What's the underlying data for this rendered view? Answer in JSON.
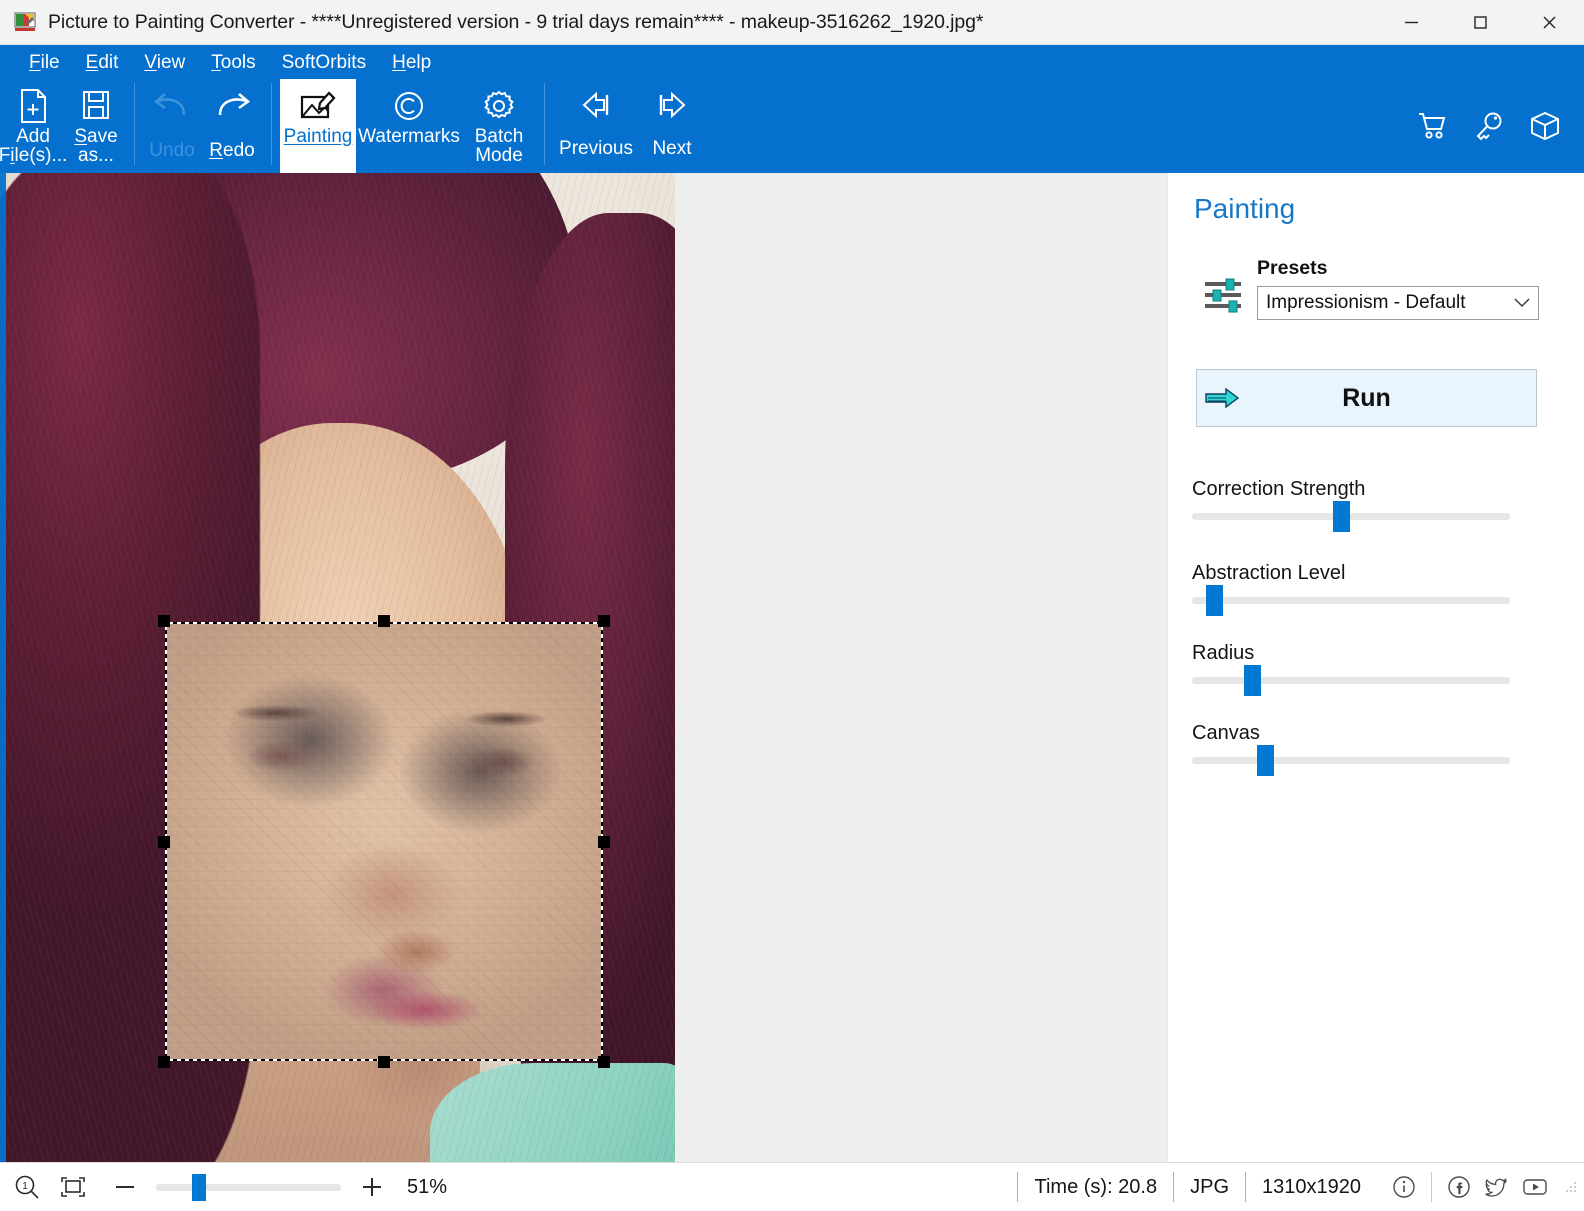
{
  "window": {
    "title": "Picture to Painting Converter - ****Unregistered version - 9 trial days remain**** - makeup-3516262_1920.jpg*",
    "app_icon": "picture-to-painting-icon",
    "minimize": "—",
    "maximize": "□",
    "close": "✕"
  },
  "menu": {
    "items": [
      {
        "label": "File",
        "accel": "F"
      },
      {
        "label": "Edit",
        "accel": "E"
      },
      {
        "label": "View",
        "accel": "V"
      },
      {
        "label": "Tools",
        "accel": "T"
      },
      {
        "label": "SoftOrbits",
        "accel": ""
      },
      {
        "label": "Help",
        "accel": "H"
      }
    ]
  },
  "toolbar": {
    "buttons": [
      {
        "label": "Add\nFile(s)...",
        "icon": "add-file-icon",
        "state": "normal"
      },
      {
        "label": "Save\nas...",
        "icon": "save-icon",
        "state": "normal"
      },
      {
        "label": "Undo",
        "icon": "undo-icon",
        "state": "disabled"
      },
      {
        "label": "Redo",
        "icon": "redo-icon",
        "state": "normal"
      },
      {
        "label": "Painting",
        "icon": "painting-icon",
        "state": "active"
      },
      {
        "label": "Watermarks",
        "icon": "copyright-icon",
        "state": "normal"
      },
      {
        "label": "Batch\nMode",
        "icon": "gear-icon",
        "state": "normal"
      },
      {
        "label": "Previous",
        "icon": "arrow-left-icon",
        "state": "normal"
      },
      {
        "label": "Next",
        "icon": "arrow-right-icon",
        "state": "normal"
      }
    ],
    "right_buttons": [
      {
        "icon": "shopping-cart-icon",
        "label": "Buy"
      },
      {
        "icon": "key-icon",
        "label": "Register"
      },
      {
        "icon": "box-icon",
        "label": "Products"
      }
    ]
  },
  "panel": {
    "title": "Painting",
    "presets_label": "Presets",
    "presets_icon": "sliders-icon",
    "preset_value": "Impressionism - Default",
    "preset_caret": "⌄",
    "run_label": "Run",
    "run_icon": "double-arrow-right-icon",
    "sliders": [
      {
        "label": "Correction Strength",
        "percent": 47
      },
      {
        "label": "Abstraction Level",
        "percent": 7
      },
      {
        "label": "Radius",
        "percent": 18
      },
      {
        "label": "Canvas",
        "percent": 22
      }
    ]
  },
  "statusbar": {
    "zoom_reset_icon": "zoom-100-icon",
    "fit_icon": "fit-to-window-icon",
    "minus": "−",
    "plus": "+",
    "zoom_percent_label": "51%",
    "zoom_slider_percent": 22,
    "cells": [
      {
        "label": "Time (s): 20.8",
        "name": "processing-time"
      },
      {
        "label": "JPG",
        "name": "file-format"
      },
      {
        "label": "1310x1920",
        "name": "image-dimensions"
      }
    ],
    "social": [
      {
        "icon": "info-icon"
      },
      {
        "icon": "facebook-icon"
      },
      {
        "icon": "twitter-icon"
      },
      {
        "icon": "youtube-icon"
      }
    ]
  },
  "colors": {
    "ribbon_blue": "#0570ce",
    "accent_blue": "#0078d4",
    "panel_title_blue": "#1878c8",
    "run_bg": "#e9f4fd",
    "teal": "#19b3b3",
    "canvas_bg": "#eeeeee"
  }
}
